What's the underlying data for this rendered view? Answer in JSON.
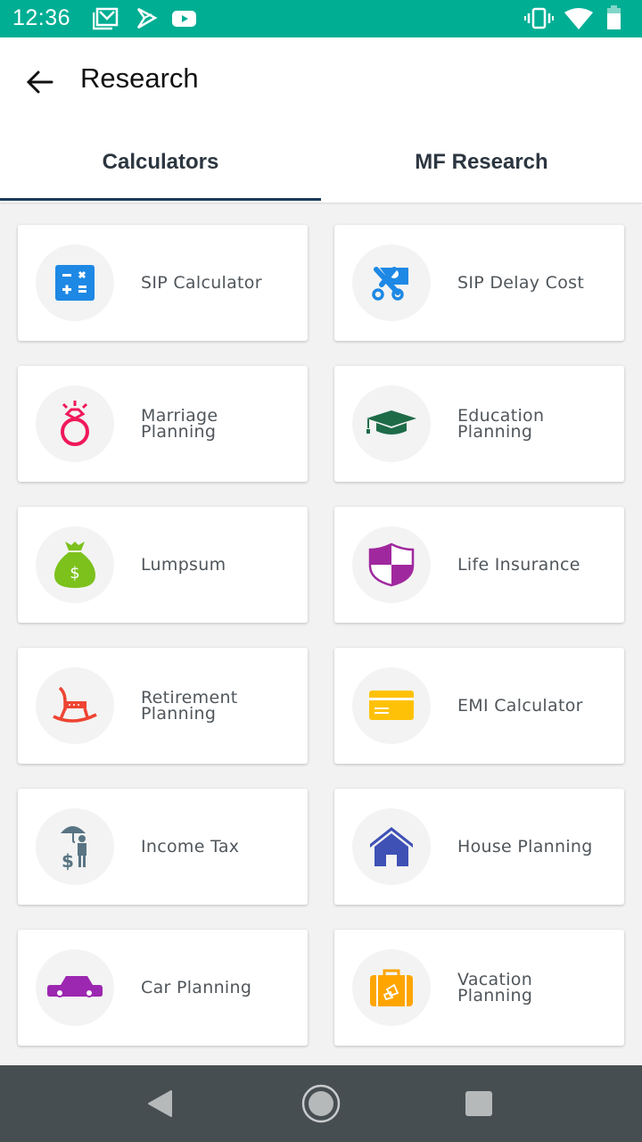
{
  "status_bar": {
    "time": "12:36",
    "left_icons": [
      "gmail-icon",
      "play-store-icon",
      "youtube-icon"
    ],
    "right_icons": [
      "vibrate-icon",
      "wifi-icon",
      "battery-icon"
    ],
    "background": "#00AE94"
  },
  "app_bar": {
    "title": "Research",
    "back_icon": "arrow-left-icon"
  },
  "tabs": [
    {
      "label": "Calculators",
      "selected": true
    },
    {
      "label": "MF Research",
      "selected": false
    }
  ],
  "tab_indicator_color": "#1B3A5C",
  "calculators": [
    {
      "label_lines": [
        "SIP Calculator"
      ],
      "icon": "calculator-icon",
      "icon_color": "#1E88E5"
    },
    {
      "label_lines": [
        "SIP Delay Cost"
      ],
      "icon": "scissors-ticket-icon",
      "icon_color": "#1E88E5"
    },
    {
      "label_lines": [
        "Marriage",
        "Planning"
      ],
      "icon": "diamond-ring-icon",
      "icon_color": "#F0185A"
    },
    {
      "label_lines": [
        "Education",
        "Planning"
      ],
      "icon": "graduation-cap-icon",
      "icon_color": "#1E6B48"
    },
    {
      "label_lines": [
        "Lumpsum"
      ],
      "icon": "money-bag-icon",
      "icon_color": "#7CC11C"
    },
    {
      "label_lines": [
        "Life Insurance"
      ],
      "icon": "shield-icon",
      "icon_color": "#A0289E"
    },
    {
      "label_lines": [
        "Retirement",
        "Planning"
      ],
      "icon": "rocking-chair-icon",
      "icon_color": "#EE4433"
    },
    {
      "label_lines": [
        "EMI Calculator"
      ],
      "icon": "credit-card-icon",
      "icon_color": "#FFC107"
    },
    {
      "label_lines": [
        "Income Tax"
      ],
      "icon": "umbrella-person-dollar-icon",
      "icon_color": "#587482"
    },
    {
      "label_lines": [
        "House Planning"
      ],
      "icon": "house-icon",
      "icon_color": "#3F51B5"
    },
    {
      "label_lines": [
        "Car Planning"
      ],
      "icon": "car-icon",
      "icon_color": "#9C27B0"
    },
    {
      "label_lines": [
        "Vacation",
        "Planning"
      ],
      "icon": "suitcase-icon",
      "icon_color": "#FFA500"
    }
  ],
  "nav_bar": {
    "buttons": [
      "back-triangle-icon",
      "home-circle-icon",
      "recents-square-icon"
    ]
  }
}
